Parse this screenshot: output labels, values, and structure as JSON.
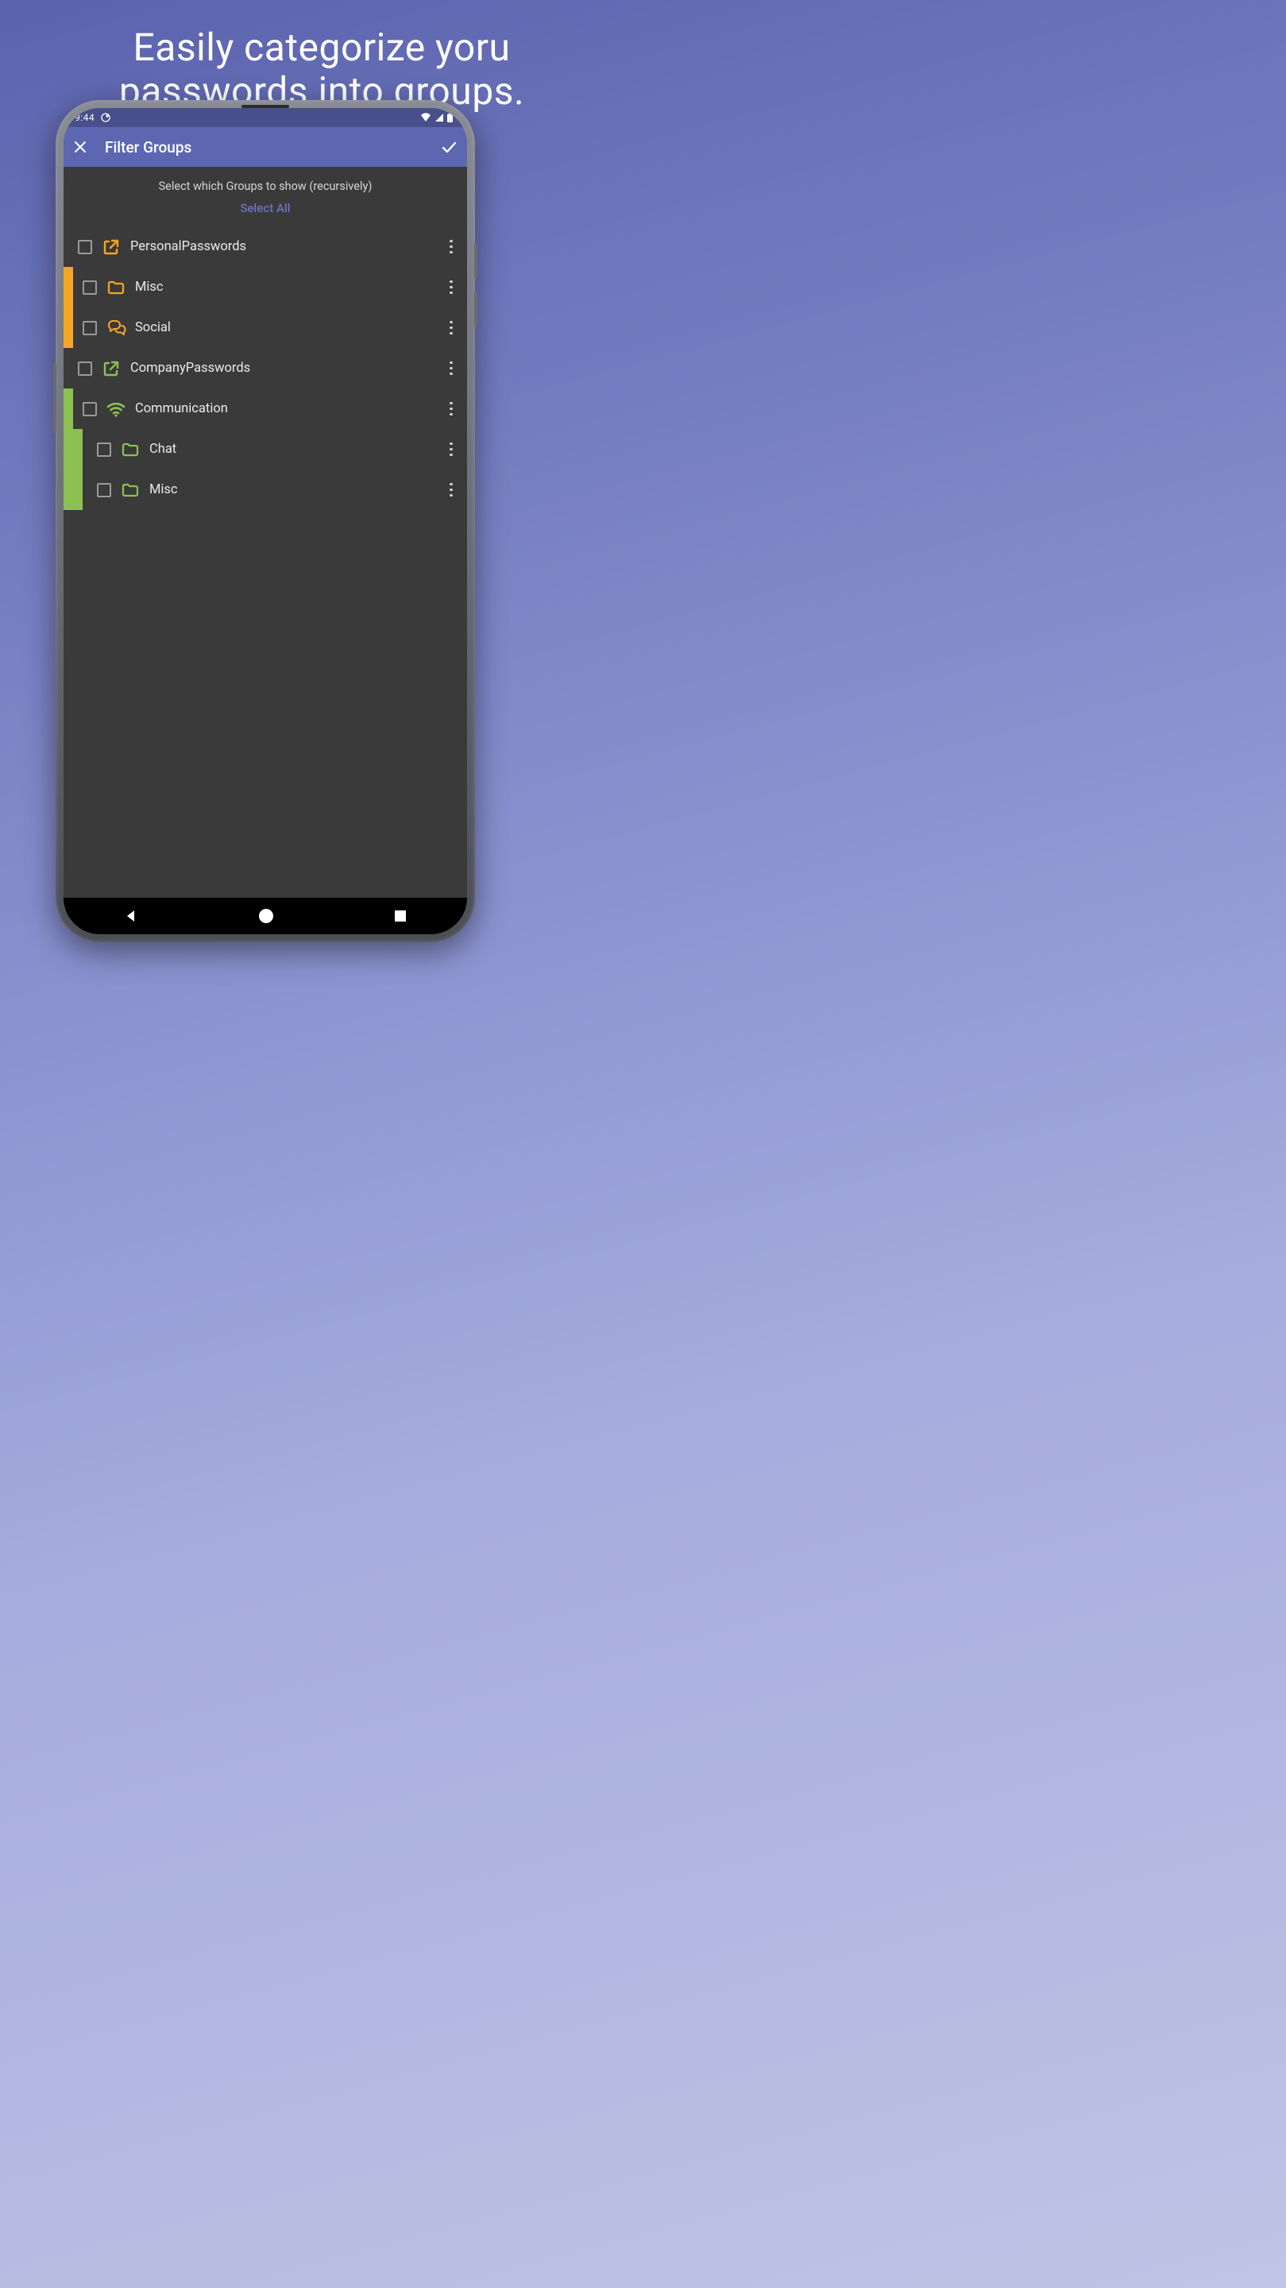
{
  "marketing": {
    "line1": "Easily categorize yoru",
    "line2": "passwords into groups."
  },
  "status": {
    "time": "9:44"
  },
  "appbar": {
    "title": "Filter Groups"
  },
  "content": {
    "header": "Select which Groups to show (recursively)",
    "select_all": "Select All"
  },
  "colors": {
    "orange": "#f5a623",
    "green": "#8cc152",
    "accent": "#5d66b1"
  },
  "groups": [
    {
      "label": "PersonalPasswords",
      "indent": 0,
      "icon": "external-open",
      "icon_color": "#f5a623",
      "gutter": "none",
      "gutter1": "",
      "gutter2": ""
    },
    {
      "label": "Misc",
      "indent": 1,
      "icon": "folder",
      "icon_color": "#f5a623",
      "gutter": "orange",
      "gutter1": "g-orange",
      "gutter2": ""
    },
    {
      "label": "Social",
      "indent": 1,
      "icon": "chat-bubbles",
      "icon_color": "#f5a623",
      "gutter": "orange",
      "gutter1": "g-orange",
      "gutter2": ""
    },
    {
      "label": "CompanyPasswords",
      "indent": 0,
      "icon": "external-open",
      "icon_color": "#8cc152",
      "gutter": "none",
      "gutter1": "",
      "gutter2": ""
    },
    {
      "label": "Communication",
      "indent": 1,
      "icon": "wifi",
      "icon_color": "#8cc152",
      "gutter": "green",
      "gutter1": "g-green",
      "gutter2": ""
    },
    {
      "label": "Chat",
      "indent": 2,
      "icon": "folder",
      "icon_color": "#8cc152",
      "gutter": "green2",
      "gutter1": "g-green",
      "gutter2": "g-green"
    },
    {
      "label": "Misc",
      "indent": 2,
      "icon": "folder",
      "icon_color": "#8cc152",
      "gutter": "green2",
      "gutter1": "g-green",
      "gutter2": "g-green"
    }
  ]
}
